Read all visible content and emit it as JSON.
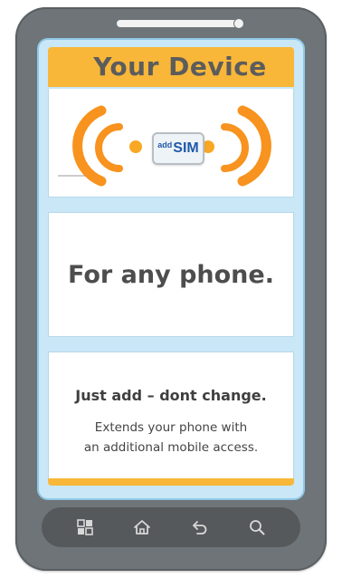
{
  "screen": {
    "title": "Your Device",
    "sim_card": {
      "prefix": "add",
      "main": "SIM"
    },
    "middle_text": "For any phone.",
    "bottom": {
      "title": "Just add – dont change.",
      "line1": "Extends your phone with",
      "line2": "an additional mobile access."
    }
  },
  "nav": {
    "buttons": [
      {
        "icon": "apps-grid-icon"
      },
      {
        "icon": "home-icon"
      },
      {
        "icon": "back-icon"
      },
      {
        "icon": "search-icon"
      }
    ]
  },
  "colors": {
    "accent_orange": "#f8b739",
    "signal_orange": "#f7931e",
    "sim_blue": "#1f5aa8",
    "phone_body": "#6e7478",
    "screen_border": "#8fc8e6"
  }
}
